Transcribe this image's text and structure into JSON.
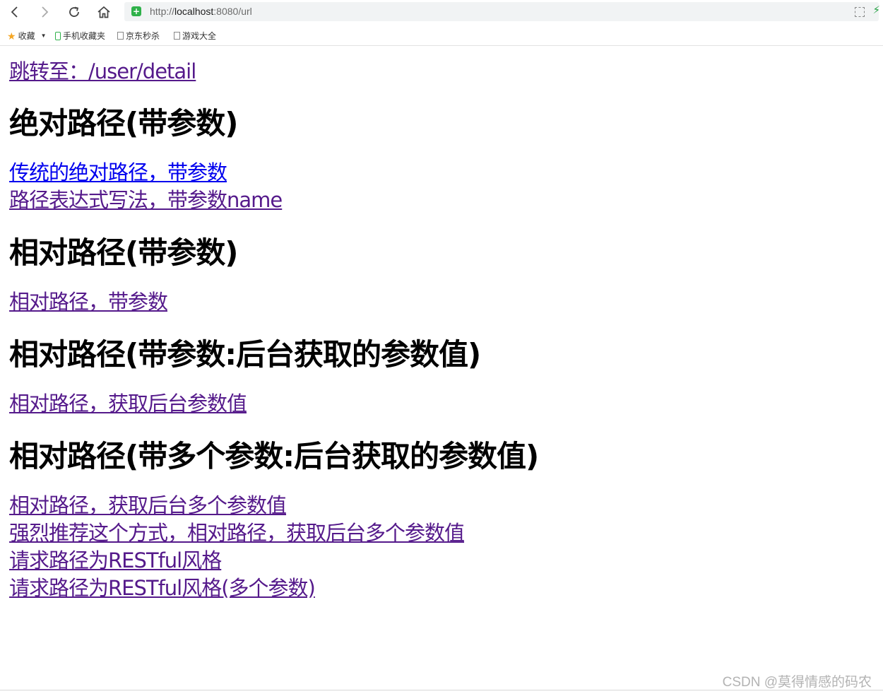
{
  "browser": {
    "url_prefix": "http://",
    "url_host": "localhost",
    "url_rest": ":8080/url",
    "icons": {
      "back": "arrow-left-icon",
      "forward": "arrow-right-icon",
      "reload": "reload-icon",
      "home": "home-icon",
      "secure": "shield-icon",
      "qr": "qr-code-icon",
      "extension": "lightning-icon"
    },
    "colors": {
      "secure_badge": "#2fb14a",
      "link_visited": "#551a8b",
      "link_unvisited": "#0000ee"
    }
  },
  "bookmarks": [
    {
      "label": "收藏",
      "icon": "star-icon"
    },
    {
      "label": "手机收藏夹",
      "icon": "phone-icon"
    },
    {
      "label": "京东秒杀",
      "icon": "document-icon"
    },
    {
      "label": "游戏大全",
      "icon": "document-icon"
    }
  ],
  "page": {
    "jump_link": "跳转至：/user/detail",
    "sections": [
      {
        "heading": "绝对路径(带参数)",
        "links": [
          "传统的绝对路径，带参数",
          "路径表达式写法，带参数name"
        ]
      },
      {
        "heading": "相对路径(带参数)",
        "links": [
          "相对路径，带参数"
        ]
      },
      {
        "heading": "相对路径(带参数:后台获取的参数值)",
        "links": [
          "相对路径，获取后台参数值"
        ]
      },
      {
        "heading": "相对路径(带多个参数:后台获取的参数值)",
        "links": [
          "相对路径，获取后台多个参数值",
          "强烈推荐这个方式，相对路径，获取后台多个参数值",
          "请求路径为RESTful风格",
          "请求路径为RESTful风格(多个参数)"
        ]
      }
    ]
  },
  "watermark": "CSDN @莫得情感的码农"
}
